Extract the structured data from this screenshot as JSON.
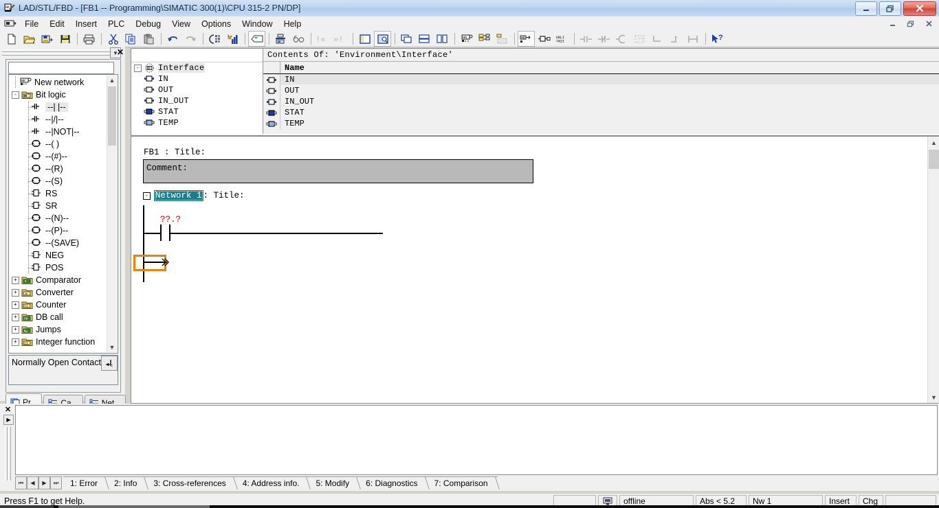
{
  "window": {
    "title": "LAD/STL/FBD  - [FB1 -- Programming\\SIMATIC 300(1)\\CPU 315-2 PN/DP]",
    "minimize": "–",
    "restore": "❐",
    "close": "✕"
  },
  "mdi": {
    "minimize": "–",
    "restore": "❐",
    "close": "✕"
  },
  "menu": {
    "items": [
      {
        "label": "File"
      },
      {
        "label": "Edit"
      },
      {
        "label": "Insert"
      },
      {
        "label": "PLC"
      },
      {
        "label": "Debug"
      },
      {
        "label": "View"
      },
      {
        "label": "Options"
      },
      {
        "label": "Window"
      },
      {
        "label": "Help"
      }
    ]
  },
  "toolbar": {
    "buttons": [
      {
        "name": "new-icon",
        "tip": "New"
      },
      {
        "name": "open-icon",
        "tip": "Open"
      },
      {
        "name": "save-as-icon",
        "tip": "Save As"
      },
      {
        "name": "save-icon",
        "tip": "Save"
      },
      {
        "name": "print-icon",
        "tip": "Print"
      },
      {
        "name": "cut-icon",
        "tip": "Cut"
      },
      {
        "name": "copy-icon",
        "tip": "Copy"
      },
      {
        "name": "paste-icon",
        "tip": "Paste"
      },
      {
        "name": "undo-icon",
        "tip": "Undo"
      },
      {
        "name": "redo-icon",
        "tip": "Redo"
      },
      {
        "name": "download-icon",
        "tip": "Download"
      },
      {
        "name": "monitor-icon",
        "tip": "Monitor"
      },
      {
        "name": "overview-icon",
        "tip": "Overview"
      },
      {
        "name": "symbol-table-icon",
        "tip": "Symbol Table"
      },
      {
        "name": "glasses-icon",
        "tip": "Monitor Variable"
      },
      {
        "name": "goto-prev-error-icon",
        "tip": "Previous Error"
      },
      {
        "name": "goto-next-error-icon",
        "tip": "Next Error"
      },
      {
        "name": "details-pane-icon",
        "tip": "Details"
      },
      {
        "name": "zoom-pane-icon",
        "tip": "Zoom"
      },
      {
        "name": "cascade-icon",
        "tip": "Cascade"
      },
      {
        "name": "tile-horizontal-icon",
        "tip": "Tile Horizontally"
      },
      {
        "name": "tile-vertical-icon",
        "tip": "Tile Vertically"
      },
      {
        "name": "new-network-icon",
        "tip": "New Network"
      },
      {
        "name": "program-elements-icon",
        "tip": "Program Elements"
      },
      {
        "name": "call-structure-icon",
        "tip": "Call Structure"
      },
      {
        "name": "lad-icon",
        "tip": "LAD"
      },
      {
        "name": "fbd-icon",
        "tip": "FBD"
      },
      {
        "name": "stl-icon",
        "tip": "STL"
      },
      {
        "name": "contact-no-icon",
        "tip": "Normally Open Contact"
      },
      {
        "name": "contact-nc-icon",
        "tip": "Normally Closed Contact"
      },
      {
        "name": "coil-icon",
        "tip": "Output Coil"
      },
      {
        "name": "empty-box-icon",
        "tip": "Empty Box"
      },
      {
        "name": "branch-open-icon",
        "tip": "Open Branch"
      },
      {
        "name": "branch-close-icon",
        "tip": "Close Branch"
      },
      {
        "name": "parallel-branch-icon",
        "tip": "Parallel Branch"
      },
      {
        "name": "help-pointer-icon",
        "tip": "What's This Help"
      }
    ]
  },
  "elements_panel": {
    "title_close": "✕",
    "dropdown_glyph": "▼",
    "search_value": "",
    "description": "Normally Open Contact",
    "desc_button_icon": "jump-to-icon",
    "tree": [
      {
        "label": "New network",
        "icon": "network-icon",
        "level": 1,
        "expander": "",
        "selected": false
      },
      {
        "label": "Bit logic",
        "icon": "folder-bit-icon",
        "level": 1,
        "expander": "-",
        "selected": false
      },
      {
        "label": "--|  |--",
        "icon": "contact-icon",
        "level": 2,
        "expander": "",
        "selected": true
      },
      {
        "label": "--|/|--",
        "icon": "contact-icon",
        "level": 2,
        "expander": "",
        "selected": false
      },
      {
        "label": "--|NOT|--",
        "icon": "contact-icon",
        "level": 2,
        "expander": "",
        "selected": false
      },
      {
        "label": "--( )",
        "icon": "coil-icon",
        "level": 2,
        "expander": "",
        "selected": false
      },
      {
        "label": "--(#)--",
        "icon": "coil-icon",
        "level": 2,
        "expander": "",
        "selected": false
      },
      {
        "label": "--(R)",
        "icon": "coil-icon",
        "level": 2,
        "expander": "",
        "selected": false
      },
      {
        "label": "--(S)",
        "icon": "coil-icon",
        "level": 2,
        "expander": "",
        "selected": false
      },
      {
        "label": "RS",
        "icon": "box-icon",
        "level": 2,
        "expander": "",
        "selected": false
      },
      {
        "label": "SR",
        "icon": "box-icon",
        "level": 2,
        "expander": "",
        "selected": false
      },
      {
        "label": "--(N)--",
        "icon": "coil-icon",
        "level": 2,
        "expander": "",
        "selected": false
      },
      {
        "label": "--(P)--",
        "icon": "coil-icon",
        "level": 2,
        "expander": "",
        "selected": false
      },
      {
        "label": "--(SAVE)",
        "icon": "coil-icon",
        "level": 2,
        "expander": "",
        "selected": false
      },
      {
        "label": "NEG",
        "icon": "box-icon",
        "level": 2,
        "expander": "",
        "selected": false
      },
      {
        "label": "POS",
        "icon": "box-icon",
        "level": 2,
        "expander": "",
        "selected": false
      },
      {
        "label": "Comparator",
        "icon": "folder-comparator-icon",
        "level": 1,
        "expander": "+",
        "selected": false
      },
      {
        "label": "Converter",
        "icon": "folder-converter-icon",
        "level": 1,
        "expander": "+",
        "selected": false
      },
      {
        "label": "Counter",
        "icon": "folder-counter-icon",
        "level": 1,
        "expander": "+",
        "selected": false
      },
      {
        "label": "DB call",
        "icon": "folder-db-icon",
        "level": 1,
        "expander": "+",
        "selected": false
      },
      {
        "label": "Jumps",
        "icon": "folder-jumps-icon",
        "level": 1,
        "expander": "+",
        "selected": false
      },
      {
        "label": "Integer function",
        "icon": "folder-integer-icon",
        "level": 1,
        "expander": "+",
        "selected": false
      }
    ],
    "tabs": [
      {
        "label": "Pr...",
        "icon": "program-elements-icon",
        "active": true
      },
      {
        "label": "Ca...",
        "icon": "call-structure-icon",
        "active": false
      },
      {
        "label": "Net...",
        "icon": "network-list-icon",
        "active": false
      }
    ]
  },
  "interface": {
    "root": {
      "label": "Interface",
      "icon": "interface-icon",
      "expander": "-"
    },
    "nodes": [
      {
        "label": "IN",
        "icon": "in-icon"
      },
      {
        "label": "OUT",
        "icon": "out-icon"
      },
      {
        "label": "IN_OUT",
        "icon": "inout-icon"
      },
      {
        "label": "STAT",
        "icon": "stat-icon"
      },
      {
        "label": "TEMP",
        "icon": "temp-icon"
      }
    ]
  },
  "contents": {
    "header": "Contents Of: 'Environment\\Interface'",
    "columns": [
      "",
      "Name"
    ],
    "rows": [
      {
        "name": "IN",
        "icon": "in-icon",
        "selected": true
      },
      {
        "name": "OUT",
        "icon": "out-icon",
        "selected": false
      },
      {
        "name": "IN_OUT",
        "icon": "inout-icon",
        "selected": false
      },
      {
        "name": "STAT",
        "icon": "stat-icon",
        "selected": false
      },
      {
        "name": "TEMP",
        "icon": "temp-icon",
        "selected": false
      }
    ]
  },
  "editor": {
    "block_title": "FB1 : Title:",
    "comment_label": "Comment:",
    "network_expander": "-",
    "network_name": "Network 1",
    "network_title_suffix": ": Title:",
    "operand_placeholder": "??.?",
    "jump_glyph": "≫",
    "selection_color": "#f08000",
    "network_highlight_color": "#15808b",
    "operand_color": "#cc0000"
  },
  "output_window": {
    "close": "✕",
    "expand": "▶",
    "nav": [
      "⏮",
      "◀",
      "▶",
      "⏭"
    ],
    "tabs": [
      {
        "label": "1: Error",
        "active": false
      },
      {
        "label": "2: Info",
        "active": false
      },
      {
        "label": "3: Cross-references",
        "active": false
      },
      {
        "label": "4: Address info.",
        "active": false
      },
      {
        "label": "5: Modify",
        "active": false
      },
      {
        "label": "6: Diagnostics",
        "active": false
      },
      {
        "label": "7: Comparison",
        "active": false
      }
    ]
  },
  "statusbar": {
    "message": "Press F1 to get Help.",
    "connection_icon": "plc-offline-icon",
    "connection": "offline",
    "absolute": "Abs < 5.2",
    "network": "Nw 1",
    "insert_mode": "Insert",
    "changed": "Chg"
  }
}
